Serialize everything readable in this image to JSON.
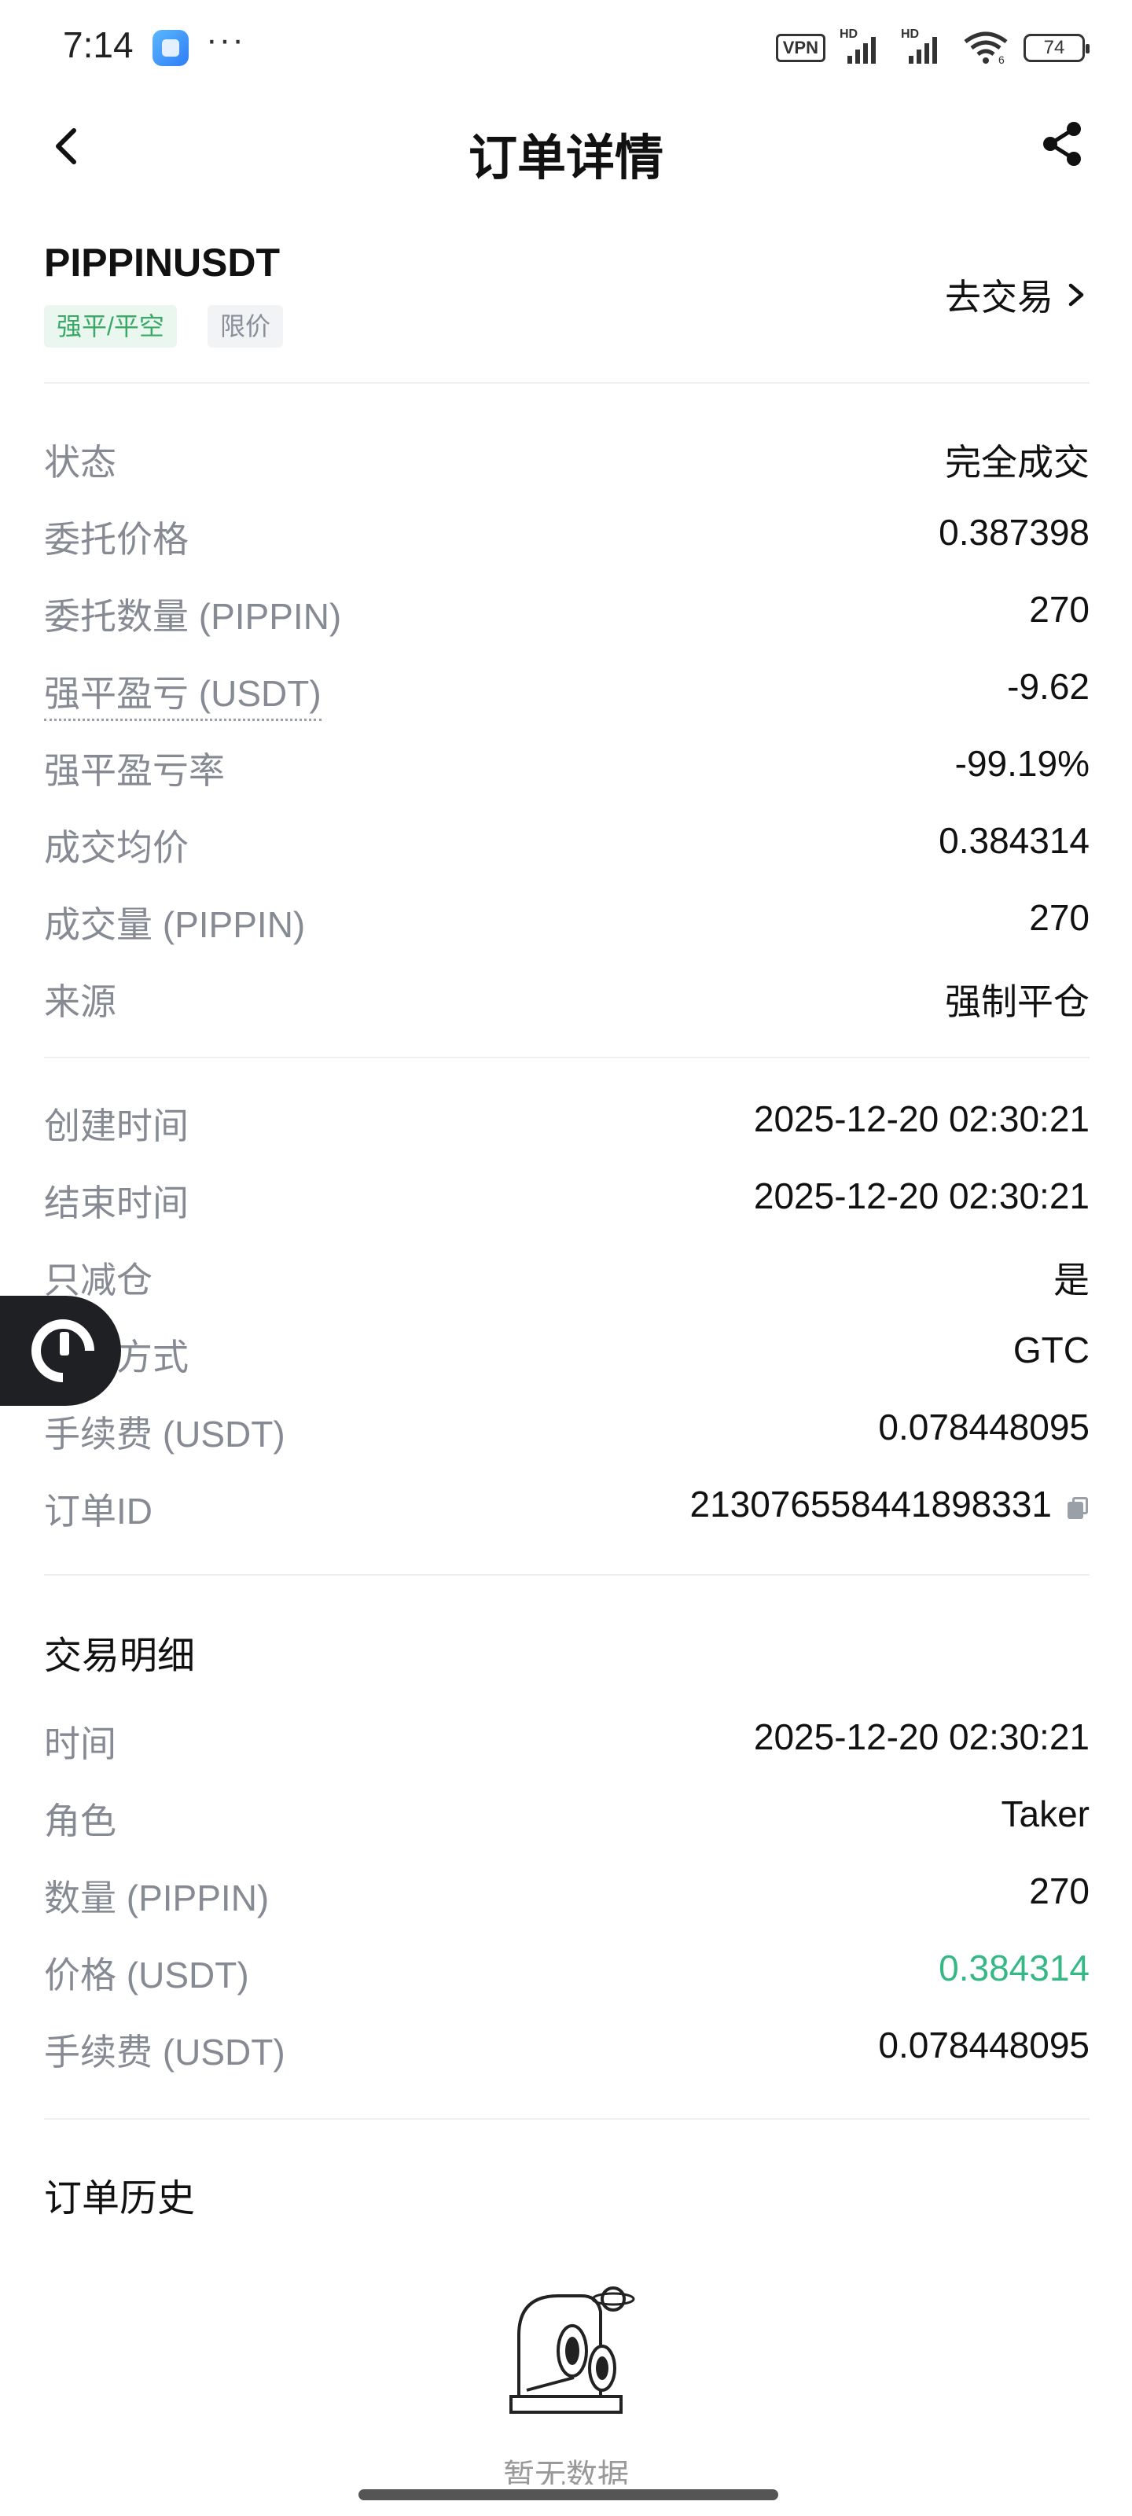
{
  "status_bar": {
    "time": "7:14",
    "dots": "···",
    "vpn": "VPN",
    "hd1": "HD",
    "hd2": "HD",
    "wifi_sub": "6",
    "battery": "74"
  },
  "header": {
    "title": "订单详情",
    "back_icon": "chevron-left-icon",
    "share_icon": "share-icon"
  },
  "symbol": {
    "name": "PIPPINUSDT",
    "tag_side": "强平/平空",
    "tag_type": "限价",
    "trade_link": "去交易",
    "colors": {
      "green_tag_text": "#3aa866",
      "green_tag_bg": "#e9f7ee"
    }
  },
  "order_info": [
    {
      "label": "状态",
      "value": "完全成交"
    },
    {
      "label": "委托价格",
      "value": "0.387398"
    },
    {
      "label": "委托数量 (PIPPIN)",
      "value": "270"
    },
    {
      "label": "强平盈亏 (USDT)",
      "value": "-9.62"
    },
    {
      "label": "强平盈亏率",
      "value": "-99.19%"
    },
    {
      "label": "成交均价",
      "value": "0.384314"
    },
    {
      "label": "成交量 (PIPPIN)",
      "value": "270"
    },
    {
      "label": "来源",
      "value": "强制平仓"
    }
  ],
  "order_meta": [
    {
      "label": "创建时间",
      "value": "2025-12-20 02:30:21"
    },
    {
      "label": "结束时间",
      "value": "2025-12-20 02:30:21"
    },
    {
      "label": "只减仓",
      "value": "是"
    },
    {
      "label": "生效方式",
      "value": "GTC"
    },
    {
      "label": "手续费 (USDT)",
      "value": "0.078448095"
    },
    {
      "label": "订单ID",
      "value": "213076558441898331"
    }
  ],
  "trade_details": {
    "title": "交易明细",
    "rows": [
      {
        "label": "时间",
        "value": "2025-12-20 02:30:21"
      },
      {
        "label": "角色",
        "value": "Taker"
      },
      {
        "label": "数量 (PIPPIN)",
        "value": "270"
      },
      {
        "label": "价格 (USDT)",
        "value": "0.384314"
      },
      {
        "label": "手续费 (USDT)",
        "value": "0.078448095"
      }
    ],
    "price_color": "#35b886"
  },
  "order_history": {
    "title": "订单历史",
    "empty_text": "暂无数据"
  }
}
